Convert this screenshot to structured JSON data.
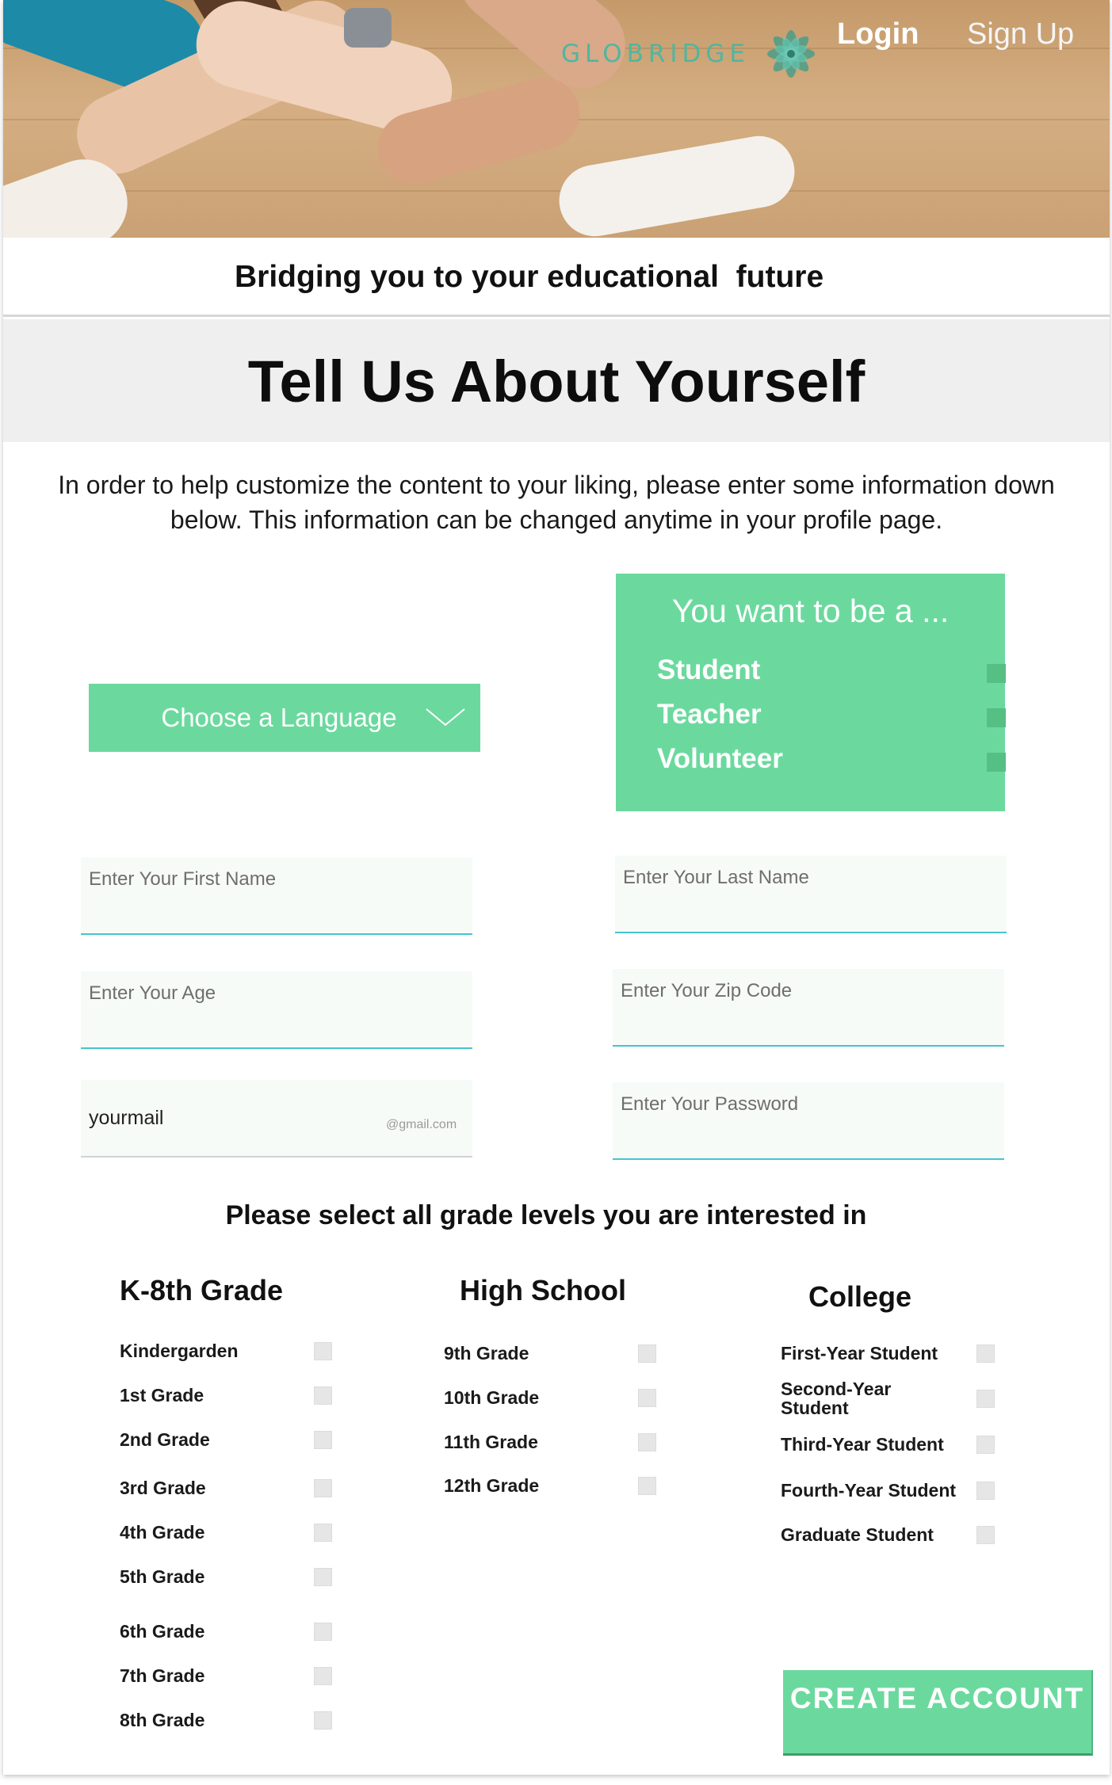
{
  "header": {
    "brand": "GLOBRIDGE",
    "login": "Login",
    "signup": "Sign Up",
    "tagline": "Bridging you to your educational  future"
  },
  "page": {
    "title": "Tell Us About Yourself",
    "intro": "In order to help customize the content to your liking, please enter some information down below.  This information can be changed anytime in your profile page."
  },
  "language": {
    "label": "Choose a Language"
  },
  "role": {
    "title": "You want to be a ...",
    "options": [
      "Student",
      "Teacher",
      "Volunteer"
    ]
  },
  "form": {
    "first_name_placeholder": "Enter Your First Name",
    "last_name_placeholder": "Enter Your Last Name",
    "age_placeholder": "Enter Your Age",
    "zip_placeholder": "Enter Your Zip Code",
    "email_value": "yourmail",
    "email_domain": "@gmail.com",
    "password_placeholder": "Enter Your Password"
  },
  "grades": {
    "prompt": "Please select all grade levels you are interested in",
    "k8": {
      "title": "K-8th Grade",
      "items": [
        "Kindergarden",
        "1st Grade",
        "2nd Grade",
        "3rd Grade",
        "4th Grade",
        "5th Grade",
        "6th Grade",
        "7th Grade",
        "8th Grade"
      ]
    },
    "high_school": {
      "title": "High School",
      "items": [
        "9th Grade",
        "10th Grade",
        "11th Grade",
        "12th Grade"
      ]
    },
    "college": {
      "title": "College",
      "items": [
        "First-Year Student",
        "Second-Year Student",
        "Third-Year Student",
        "Fourth-Year Student",
        "Graduate Student"
      ]
    }
  },
  "actions": {
    "create_account": "CREATE ACCOUNT"
  },
  "colors": {
    "accent": "#6bd99e",
    "brand_teal": "#4fb6a0",
    "input_underline": "#45c4cf"
  },
  "icons": {
    "brand": "flower-logo-icon",
    "dropdown": "chevron-down-icon"
  }
}
